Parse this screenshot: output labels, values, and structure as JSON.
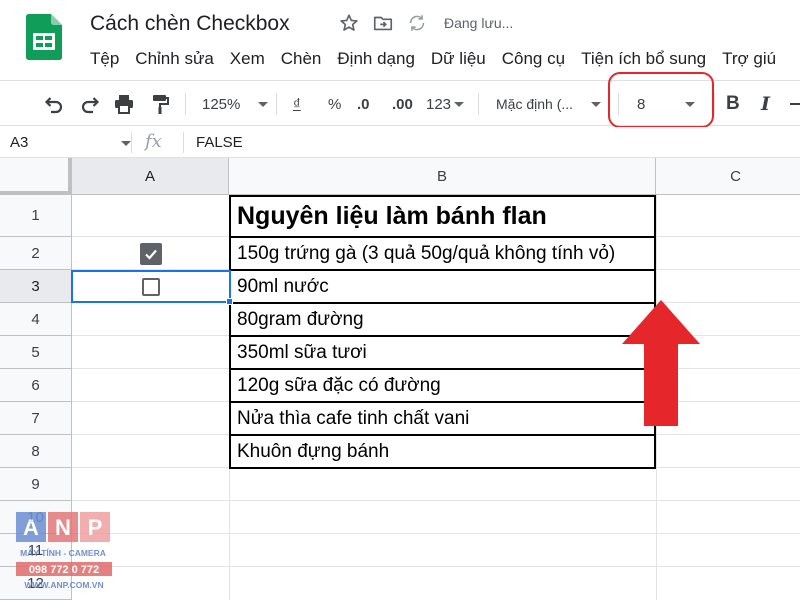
{
  "app": {
    "doc_title": "Cách chèn Checkbox",
    "save_status": "Đang lưu...",
    "icons": [
      "sheets-logo-icon",
      "star-icon",
      "move-folder-icon",
      "sync-icon"
    ]
  },
  "menu": [
    "Tệp",
    "Chỉnh sửa",
    "Xem",
    "Chèn",
    "Định dạng",
    "Dữ liệu",
    "Công cụ",
    "Tiện ích bổ sung",
    "Trợ giú"
  ],
  "toolbar": {
    "zoom": "125%",
    "currency": "₫",
    "percent": "%",
    "decimal_decrease": ".0",
    "decimal_increase": ".00",
    "more_formats": "123",
    "font_family": "Mặc định (...",
    "font_size": "8",
    "bold": "B",
    "italic": "I",
    "icons": [
      "undo-icon",
      "redo-icon",
      "print-icon",
      "paint-format-icon",
      "strikethrough-icon"
    ]
  },
  "formula_bar": {
    "cell_ref": "A3",
    "fx": "fx",
    "value": "FALSE"
  },
  "grid": {
    "columns": [
      "A",
      "B",
      "C"
    ],
    "row_numbers": [
      "1",
      "2",
      "3",
      "4",
      "5",
      "6",
      "7",
      "8",
      "9",
      "10",
      "11",
      "12"
    ],
    "selected_cell": "A3",
    "rows": [
      {
        "a_checkbox": null,
        "b": "Nguyên liệu làm bánh flan"
      },
      {
        "a_checkbox": true,
        "b": "150g trứng gà (3 quả 50g/quả không tính vỏ)"
      },
      {
        "a_checkbox": false,
        "b": "90ml nước"
      },
      {
        "a_checkbox": null,
        "b": "80gram đường"
      },
      {
        "a_checkbox": null,
        "b": "350ml sữa tươi"
      },
      {
        "a_checkbox": null,
        "b": "120g sữa đặc có đường"
      },
      {
        "a_checkbox": null,
        "b": "Nửa thìa cafe tinh chất vani"
      },
      {
        "a_checkbox": null,
        "b": "Khuôn đựng bánh"
      }
    ]
  },
  "watermark": {
    "letters": [
      "A",
      "N",
      "P"
    ],
    "tagline": "MÁY TÍNH - CAMERA",
    "phone": "098 772 0 772",
    "site": "WWW.ANP.COM.VN"
  },
  "colors": {
    "sheets_green": "#0f9d58",
    "selection_blue": "#1a73e8",
    "annotation_red": "#e5262b",
    "checkbox_gray": "#5f6368"
  }
}
